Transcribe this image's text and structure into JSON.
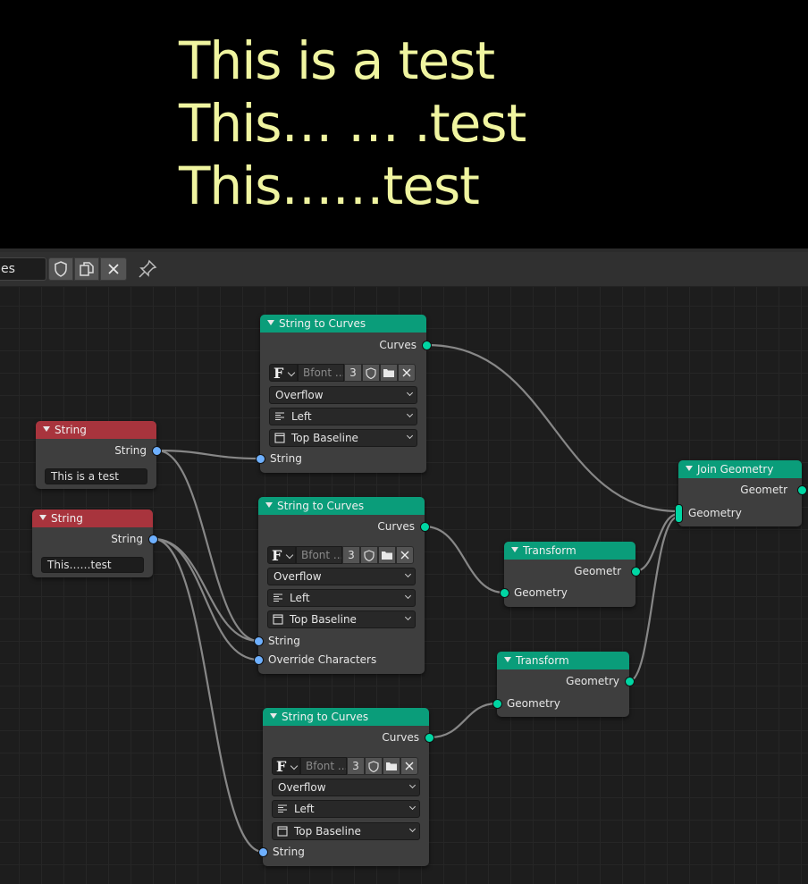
{
  "viewport": {
    "lines": [
      "This is a test",
      "This… … .test",
      "This……test"
    ],
    "text_color": "#f0f5a0"
  },
  "header": {
    "tree_name": "es",
    "buttons": [
      "shield-icon",
      "duplicate-icon",
      "close-icon",
      "pin-icon"
    ]
  },
  "nodes": {
    "string1": {
      "title": "String",
      "output": "String",
      "value": "This is a test"
    },
    "string2": {
      "title": "String",
      "output": "String",
      "value": "This……test"
    },
    "stc1": {
      "title": "String to Curves",
      "output": "Curves",
      "font": "Bfont ...",
      "users": "3",
      "overflow": "Overflow",
      "align_x": "Left",
      "align_y": "Top Baseline",
      "inputs": [
        "String"
      ]
    },
    "stc2": {
      "title": "String to Curves",
      "output": "Curves",
      "font": "Bfont ...",
      "users": "3",
      "overflow": "Overflow",
      "align_x": "Left",
      "align_y": "Top Baseline",
      "inputs": [
        "String",
        "Override Characters"
      ]
    },
    "stc3": {
      "title": "String to Curves",
      "output": "Curves",
      "font": "Bfont ...",
      "users": "3",
      "overflow": "Overflow",
      "align_x": "Left",
      "align_y": "Top Baseline",
      "inputs": [
        "String"
      ]
    },
    "transform1": {
      "title": "Transform",
      "output": "Geometr",
      "input": "Geometry"
    },
    "transform2": {
      "title": "Transform",
      "output": "Geometry",
      "input": "Geometry"
    },
    "join": {
      "title": "Join Geometry",
      "output": "Geometr",
      "input": "Geometry"
    }
  },
  "colors": {
    "geometry_socket": "#00d6a3",
    "string_socket": "#6eb0ff",
    "geometry_header": "#0a9d7a",
    "input_header": "#a8343d"
  }
}
